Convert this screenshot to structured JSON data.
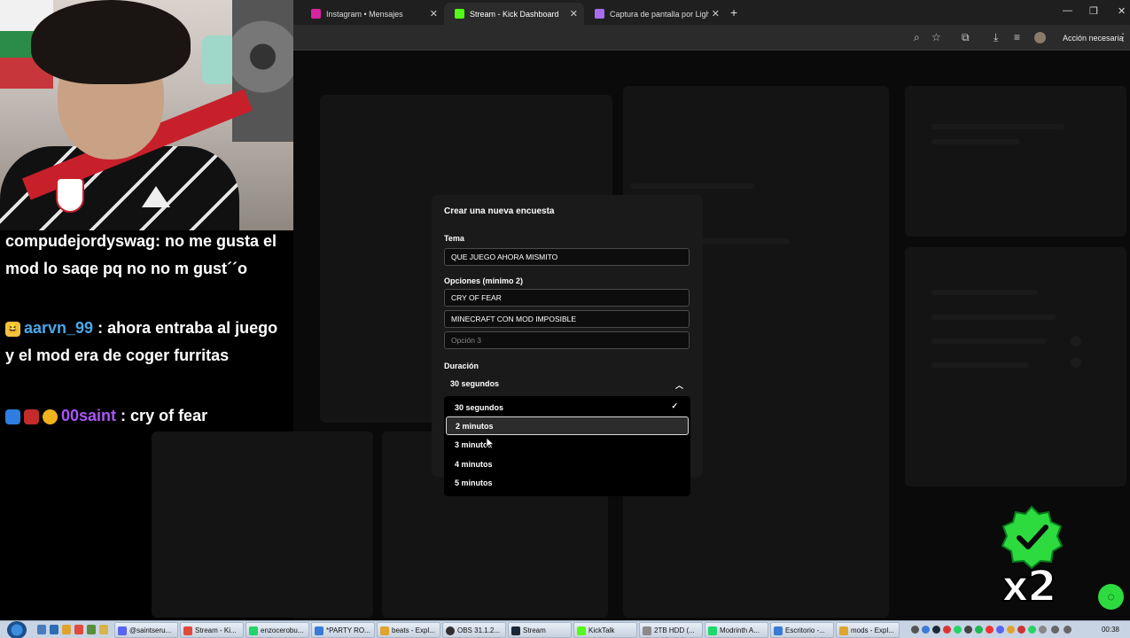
{
  "browser": {
    "tabs": [
      {
        "label": "Instagram • Mensajes",
        "icon": "instagram-icon",
        "color": "#d6249f"
      },
      {
        "label": "Stream - Kick Dashboard",
        "icon": "kick-icon",
        "color": "#53fc18"
      },
      {
        "label": "Captura de pantalla por Lightshot",
        "icon": "lightshot-icon",
        "color": "#a76cf0"
      }
    ],
    "action_label": "Acción necesaria"
  },
  "chat": {
    "messages": [
      {
        "user": "compudejordyswag",
        "sep": ":",
        "text": " no me gusta el mod lo saqe pq no no m gust´´o"
      },
      {
        "user": "aarvn_99",
        "sep": " :",
        "text": " ahora entraba al juego y el mod era de coger furritas"
      },
      {
        "user": "00saint",
        "sep": " :",
        "text": " cry of fear"
      }
    ]
  },
  "modal": {
    "title": "Crear una nueva encuesta",
    "topic_label": "Tema",
    "topic_value": "QUE JUEGO AHORA MISMITO",
    "options_label": "Opciones (mínimo 2)",
    "option_1": "CRY OF FEAR",
    "option_2": "MINECRAFT CON MOD IMPOSIBLE",
    "option_3_placeholder": "Opción 3",
    "duration_label": "Duración",
    "duration_value": "30 segundos",
    "duration_options": [
      "30 segundos",
      "2 minutos",
      "3 minutos",
      "4 minutos",
      "5 minutos"
    ],
    "selected_index": 0,
    "highlighted_index": 1
  },
  "overlay": {
    "multiplier": "x2"
  },
  "taskbar": {
    "items": [
      "@saintseru...",
      "Stream - Ki...",
      "enzocerobu...",
      "*PARTY RO...",
      "beats - Expl...",
      "OBS 31.1.2...",
      "Stream",
      "KickTalk",
      "2TB HDD (...",
      "Modrinth A...",
      "Escritorio -...",
      "mods - Expl..."
    ],
    "clock": "00:38"
  },
  "colors": {
    "kick_green": "#53fc18",
    "badge_green": "#2ddb3e",
    "modal_bg": "#1a1a1a"
  }
}
